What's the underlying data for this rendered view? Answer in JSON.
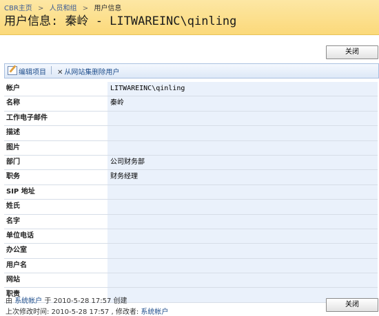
{
  "breadcrumb": {
    "items": [
      "CBR主页",
      "人员和组",
      "用户信息"
    ],
    "separator": ">"
  },
  "page": {
    "title": "用户信息: 秦岭 - LITWAREINC\\qinling"
  },
  "buttons": {
    "close_top": "关闭",
    "close_bottom": "关闭"
  },
  "toolbar": {
    "edit_label": "编辑项目",
    "delete_label": "从网站集删除用户"
  },
  "fields": [
    {
      "label": "帐户",
      "value": "LITWAREINC\\qinling"
    },
    {
      "label": "名称",
      "value": "秦岭"
    },
    {
      "label": "工作电子邮件",
      "value": ""
    },
    {
      "label": "描述",
      "value": ""
    },
    {
      "label": "图片",
      "value": ""
    },
    {
      "label": "部门",
      "value": "公司财务部"
    },
    {
      "label": "职务",
      "value": "财务经理"
    },
    {
      "label": "SIP 地址",
      "value": ""
    },
    {
      "label": "姓氏",
      "value": ""
    },
    {
      "label": "名字",
      "value": ""
    },
    {
      "label": "单位电话",
      "value": ""
    },
    {
      "label": "办公室",
      "value": ""
    },
    {
      "label": "用户名",
      "value": ""
    },
    {
      "label": "网站",
      "value": ""
    },
    {
      "label": "职责",
      "value": ""
    }
  ],
  "footer": {
    "created_prefix": "由",
    "created_by": "系统帐户",
    "created_at": "于 2010-5-28 17:57",
    "created_suffix": "创建",
    "modified_prefix": "上次修改时间: 2010-5-28 17:57 , 修改者:",
    "modified_by": "系统帐户"
  },
  "colors": {
    "header_bg": "#fbd97a",
    "value_bg": "#eaf1fb",
    "link": "#1f4e8c"
  }
}
